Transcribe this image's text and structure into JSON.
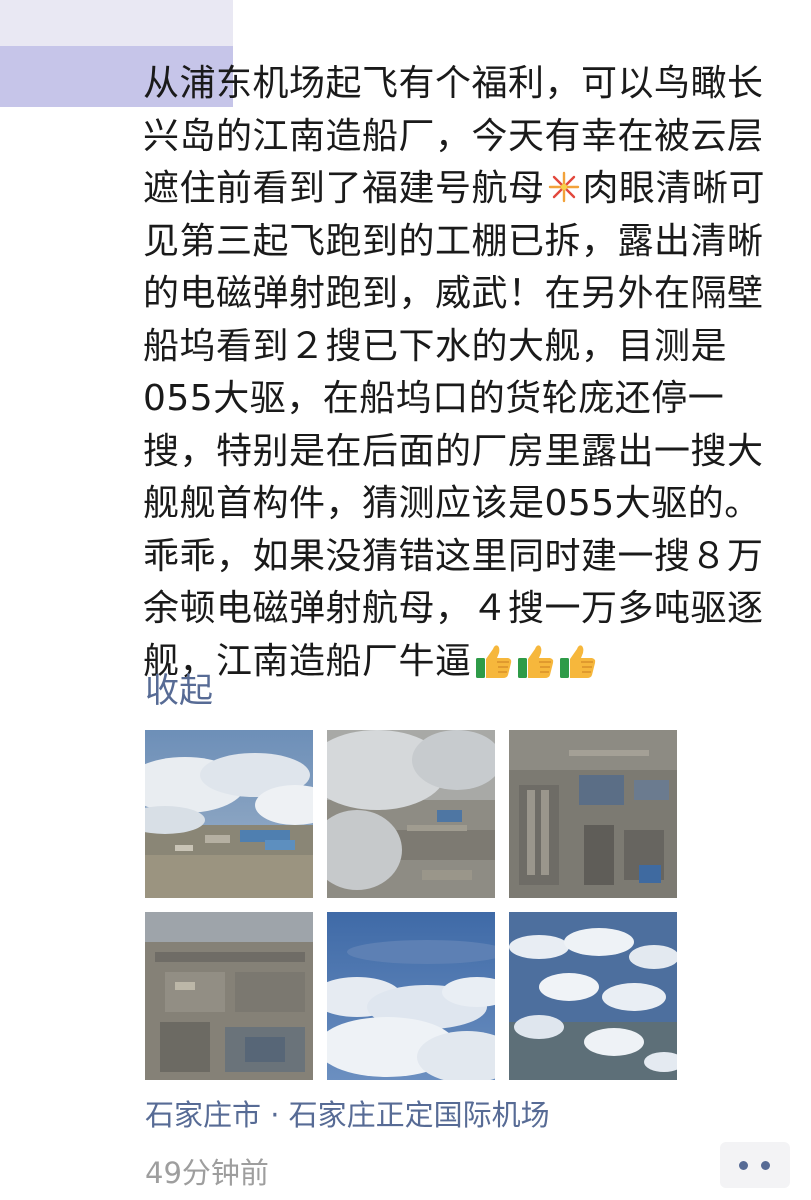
{
  "post": {
    "lines": [
      "从浦东机场起飞有个福利，可以鸟瞰长",
      "兴岛的江南造船厂，今天有幸在被云层",
      "遮住前看到了福建号航母",
      "肉眼清晰可",
      "见第三起飞跑到的工棚已拆，露出清晰",
      "的电磁弹射跑到，威武！在另外在隔壁",
      "船坞看到２搜已下水的大舰，目测是",
      "055大驱，在船坞口的货轮庞还停一",
      "搜，特别是在后面的厂房里露出一搜大",
      "舰舰首构件，猜测应该是055大驱的。",
      "乖乖，如果没猜错这里同时建一搜８万",
      "余顿电磁弹射航母，４搜一万多吨驱逐",
      "舰，江南造船厂牛逼"
    ],
    "emojis": {
      "inline_1": "fireworks-emoji",
      "trailing": [
        "thumbs-up-emoji",
        "thumbs-up-emoji",
        "thumbs-up-emoji"
      ]
    },
    "collapse_label": "收起",
    "location": "石家庄市 · 石家庄正定国际机场",
    "time": "49分钟前"
  },
  "photos": [
    {
      "name": "photo-1",
      "subject": "clouds-over-shipyard"
    },
    {
      "name": "photo-2",
      "subject": "clouds-over-docks"
    },
    {
      "name": "photo-3",
      "subject": "shipyard-aerial"
    },
    {
      "name": "photo-4",
      "subject": "industrial-area-aerial"
    },
    {
      "name": "photo-5",
      "subject": "cloud-layer"
    },
    {
      "name": "photo-6",
      "subject": "scattered-clouds"
    }
  ],
  "colors": {
    "link": "#576b95",
    "text": "#1a1a1a",
    "meta": "#9e9e9e",
    "avatar": "#c6c5e9"
  }
}
